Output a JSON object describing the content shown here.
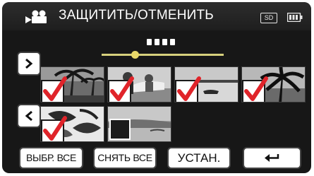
{
  "header": {
    "title": "ЗАЩИТИТЬ/ОТМЕНИТЬ",
    "mode_icon": "video-camera-icon",
    "storage_badge": "SD",
    "battery_icon": "battery-icon"
  },
  "pager": {
    "pages": 4,
    "slider_position": 0.27
  },
  "navigation": {
    "next_icon": "chevron-right-icon",
    "prev_icon": "chevron-left-icon"
  },
  "thumbnails": [
    {
      "checked": true,
      "scene": "palm-trees"
    },
    {
      "checked": true,
      "scene": "boat-people"
    },
    {
      "checked": true,
      "scene": "sea-horizon"
    },
    {
      "checked": true,
      "scene": "palm-silhouette"
    },
    {
      "checked": true,
      "scene": "leaves"
    },
    {
      "checked": false,
      "scene": "river-bank"
    }
  ],
  "buttons": {
    "select_all": "ВЫБР. ВСЕ",
    "clear_all": "СНЯТЬ ВСЕ",
    "set": "УСТАН.",
    "back_icon": "return-arrow-icon"
  },
  "colors": {
    "check_mark": "#e0242a",
    "slider_track": "#d6d07c",
    "slider_knob": "#e8d86a"
  }
}
